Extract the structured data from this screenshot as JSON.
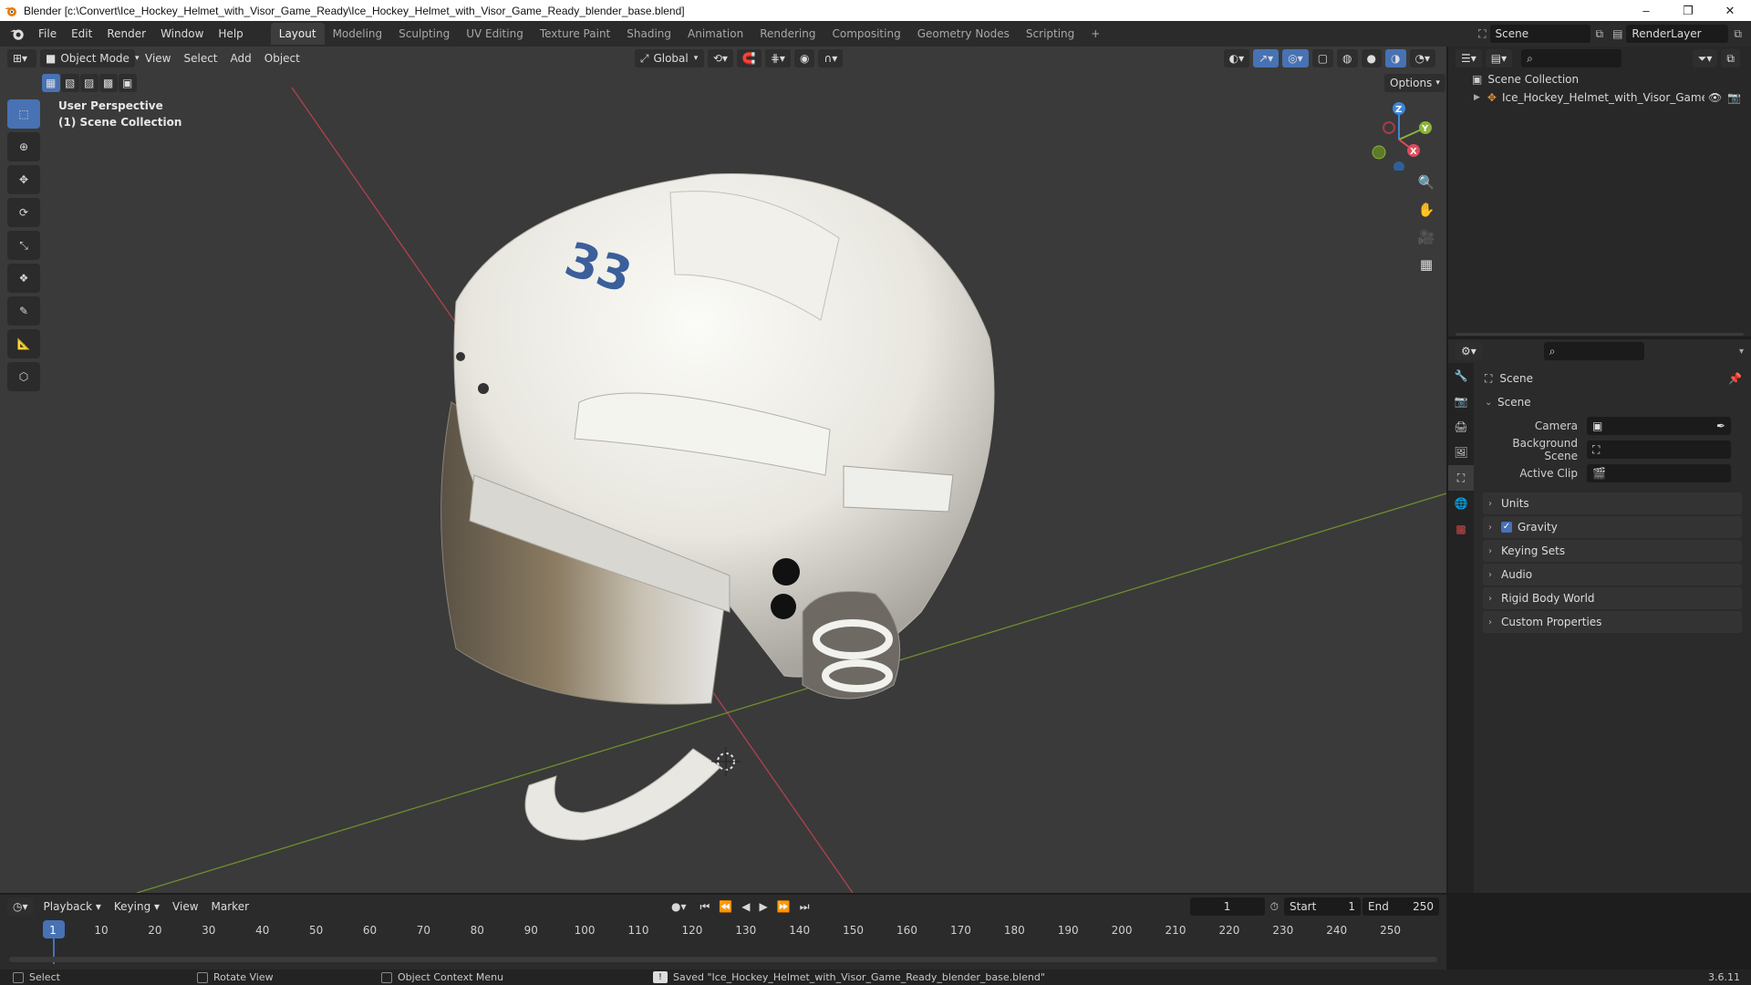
{
  "window": {
    "title": "Blender [c:\\Convert\\Ice_Hockey_Helmet_with_Visor_Game_Ready\\Ice_Hockey_Helmet_with_Visor_Game_Ready_blender_base.blend]",
    "minimize": "–",
    "maximize": "❐",
    "close": "✕"
  },
  "menubar": {
    "items": [
      "File",
      "Edit",
      "Render",
      "Window",
      "Help"
    ],
    "workspaces": [
      "Layout",
      "Modeling",
      "Sculpting",
      "UV Editing",
      "Texture Paint",
      "Shading",
      "Animation",
      "Rendering",
      "Compositing",
      "Geometry Nodes",
      "Scripting"
    ],
    "active_workspace": "Layout",
    "add_workspace": "+",
    "scene": "Scene",
    "view_layer": "RenderLayer"
  },
  "viewport": {
    "mode": "Object Mode",
    "menus": [
      "View",
      "Select",
      "Add",
      "Object"
    ],
    "orientation": "Global",
    "options": "Options",
    "overlay_title": "User Perspective",
    "overlay_subtitle": "(1) Scene Collection",
    "helmet_number": "33",
    "gizmo": {
      "x": "X",
      "y": "Y",
      "z": "Z"
    }
  },
  "outliner": {
    "root": "Scene Collection",
    "object": "Ice_Hockey_Helmet_with_Visor_Game_"
  },
  "properties": {
    "context": "Scene",
    "section": "Scene",
    "fields": [
      {
        "label": "Camera"
      },
      {
        "label": "Background Scene"
      },
      {
        "label": "Active Clip"
      }
    ],
    "panels": [
      "Units",
      "Gravity",
      "Keying Sets",
      "Audio",
      "Rigid Body World",
      "Custom Properties"
    ],
    "gravity_checked": true
  },
  "timeline": {
    "menus": [
      "Playback",
      "Keying",
      "View",
      "Marker"
    ],
    "current_frame": "1",
    "start_label": "Start",
    "start": "1",
    "end_label": "End",
    "end": "250",
    "ticks": [
      "1",
      "10",
      "20",
      "30",
      "40",
      "50",
      "60",
      "70",
      "80",
      "90",
      "100",
      "110",
      "120",
      "130",
      "140",
      "150",
      "160",
      "170",
      "180",
      "190",
      "200",
      "210",
      "220",
      "230",
      "240",
      "250"
    ]
  },
  "statusbar": {
    "select": "Select",
    "rotate": "Rotate View",
    "context_menu": "Object Context Menu",
    "message": "Saved \"Ice_Hockey_Helmet_with_Visor_Game_Ready_blender_base.blend\"",
    "version": "3.6.11"
  },
  "colors": {
    "accent": "#4772b3",
    "axis_x": "#e04a5c",
    "axis_y": "#8bb33b",
    "axis_z": "#3f86d9"
  }
}
